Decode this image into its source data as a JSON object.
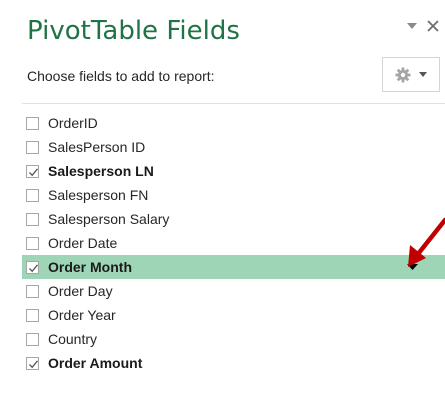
{
  "pane": {
    "title": "PivotTable Fields",
    "subheader": "Choose fields to add to report:",
    "icons": {
      "dropdown": "chevron-down-icon",
      "close": "close-icon",
      "tools": "gear-icon",
      "tools_dropdown": "chevron-down-icon"
    },
    "accent_color": "#217346",
    "selected_row_color": "#9fd5b7",
    "annotation_color": "#c00000"
  },
  "fields": [
    {
      "label": "OrderID",
      "checked": false,
      "bold": false,
      "selected": false
    },
    {
      "label": "SalesPerson ID",
      "checked": false,
      "bold": false,
      "selected": false
    },
    {
      "label": "Salesperson LN",
      "checked": true,
      "bold": true,
      "selected": false
    },
    {
      "label": "Salesperson FN",
      "checked": false,
      "bold": false,
      "selected": false
    },
    {
      "label": "Salesperson Salary",
      "checked": false,
      "bold": false,
      "selected": false
    },
    {
      "label": "Order Date",
      "checked": false,
      "bold": false,
      "selected": false
    },
    {
      "label": "Order Month",
      "checked": true,
      "bold": true,
      "selected": true
    },
    {
      "label": "Order Day",
      "checked": false,
      "bold": false,
      "selected": false
    },
    {
      "label": "Order Year",
      "checked": false,
      "bold": false,
      "selected": false
    },
    {
      "label": "Country",
      "checked": false,
      "bold": false,
      "selected": false
    },
    {
      "label": "Order Amount",
      "checked": true,
      "bold": true,
      "selected": false
    }
  ]
}
